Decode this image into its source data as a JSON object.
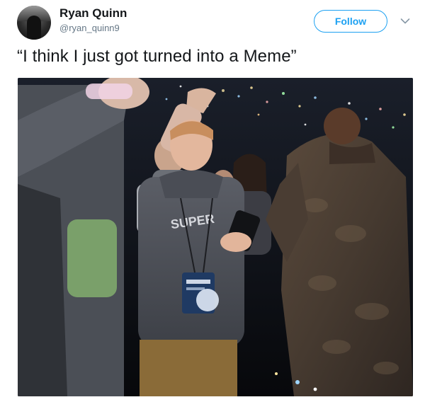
{
  "tweet": {
    "author": {
      "display_name": "Ryan Quinn",
      "handle": "@ryan_quinn9",
      "avatar_icon": "profile-photo"
    },
    "follow_label": "Follow",
    "menu_icon": "chevron-down-icon",
    "text": "“I think I just got turned into a Meme”",
    "media": {
      "kind": "photo",
      "shirt_print": "SUPER"
    }
  },
  "colors": {
    "accent": "#1da1f2",
    "text_primary": "#14171a",
    "text_secondary": "#657786"
  }
}
